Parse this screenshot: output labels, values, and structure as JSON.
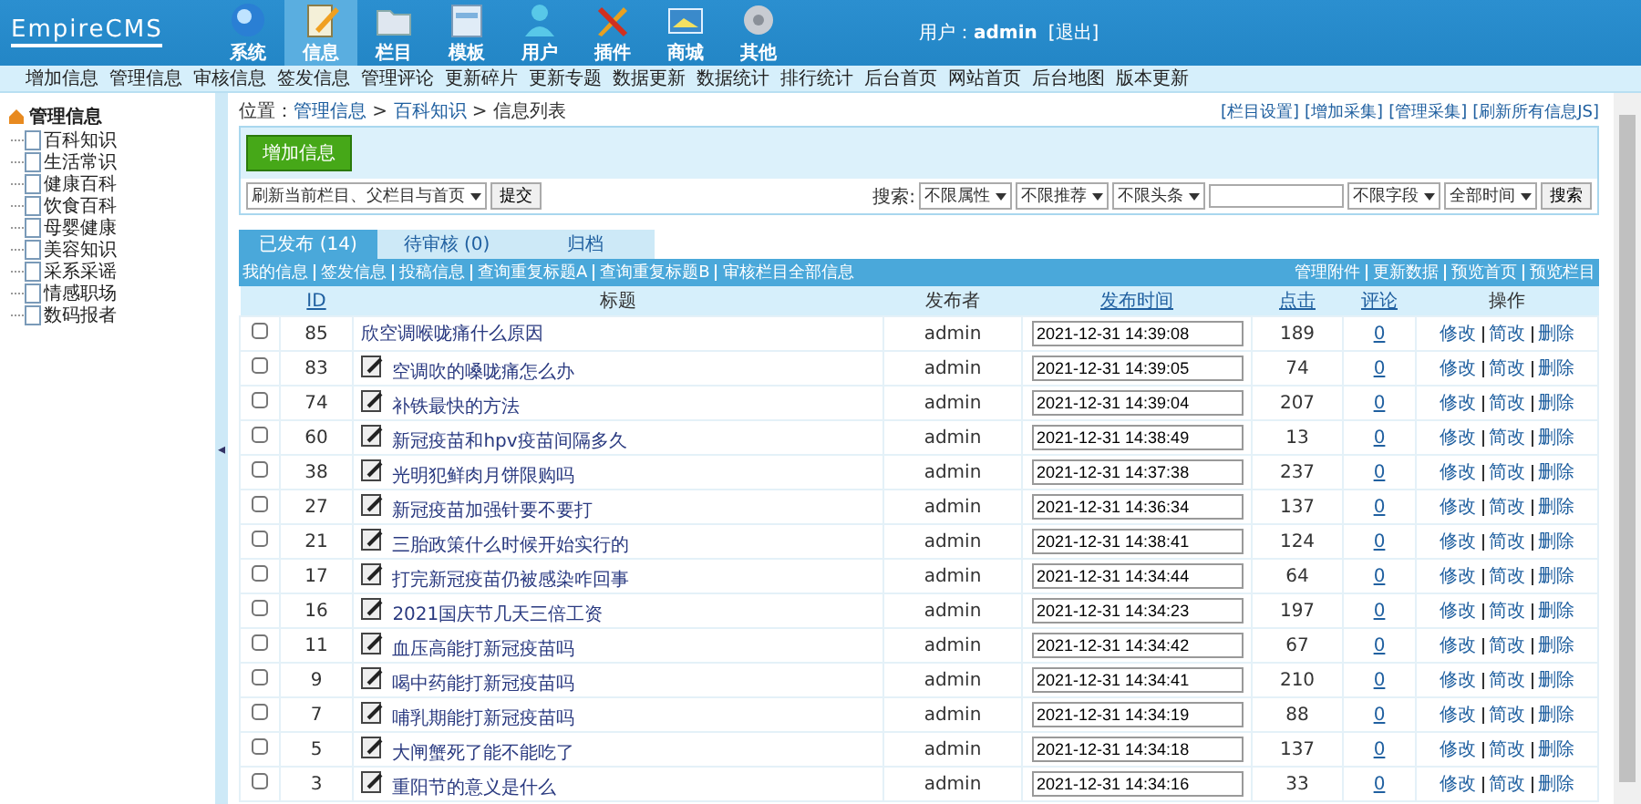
{
  "header": {
    "logo": "EmpireCMS",
    "nav": [
      {
        "label": "系统",
        "kind": "globe",
        "selected": false
      },
      {
        "label": "信息",
        "kind": "notepad",
        "selected": true
      },
      {
        "label": "栏目",
        "kind": "folder",
        "selected": false
      },
      {
        "label": "模板",
        "kind": "window",
        "selected": false
      },
      {
        "label": "用户",
        "kind": "person",
        "selected": false
      },
      {
        "label": "插件",
        "kind": "tools",
        "selected": false
      },
      {
        "label": "商城",
        "kind": "card",
        "selected": false
      },
      {
        "label": "其他",
        "kind": "gear",
        "selected": false
      }
    ],
    "user_label": "用户：",
    "user": "admin",
    "logout": "[退出]"
  },
  "submenu": [
    "增加信息",
    "管理信息",
    "审核信息",
    "签发信息",
    "管理评论",
    "更新碎片",
    "更新专题",
    "数据更新",
    "数据统计",
    "排行统计",
    "后台首页",
    "网站首页",
    "后台地图",
    "版本更新"
  ],
  "sidebar": {
    "tree": [
      {
        "label": "管理信息",
        "children": [
          {
            "label": "百科知识"
          },
          {
            "label": "生活常识"
          },
          {
            "label": "健康百科"
          },
          {
            "label": "饮食百科"
          },
          {
            "label": "母婴健康"
          },
          {
            "label": "美容知识"
          },
          {
            "label": "采系采谣"
          },
          {
            "label": "情感职场"
          },
          {
            "label": "数码报者"
          }
        ]
      }
    ],
    "collapse": "◂"
  },
  "breadcrumb": {
    "label": "位置：",
    "items": [
      {
        "text": "管理信息",
        "kind": "link"
      },
      {
        "text": " > ",
        "kind": "sep"
      },
      {
        "text": "百科知识",
        "kind": "link"
      },
      {
        "text": " > 信息列表",
        "kind": "text"
      }
    ]
  },
  "top_links": [
    "[栏目设置]",
    "[增加采集]",
    "[管理采集]",
    "[刷新所有信息JS]"
  ],
  "add_button": "增加信息",
  "refresh_select": "刷新当前栏目、父栏目与首页",
  "submit_button": "提交",
  "search": {
    "label": "搜索:",
    "filters": [
      "不限属性",
      "不限推荐",
      "不限头条"
    ],
    "field_filters": [
      "不限字段",
      "全部时间"
    ],
    "button": "搜索"
  },
  "tabs": [
    {
      "label": "已发布 (14)",
      "selected": true
    },
    {
      "label": "待审核 (0)",
      "selected": false
    },
    {
      "label": "归档",
      "selected": false
    }
  ],
  "links_left": [
    "我的信息",
    "签发信息",
    "投稿信息",
    "查询重复标题A",
    "查询重复标题B",
    "审核栏目全部信息"
  ],
  "links_right": [
    "管理附件",
    "更新数据",
    "预览首页",
    "预览栏目"
  ],
  "table": {
    "columns": [
      {
        "kind": "blank"
      },
      {
        "label": "ID",
        "kind": "link"
      },
      {
        "label": "标题",
        "kind": "plain"
      },
      {
        "label": "发布者",
        "kind": "plain"
      },
      {
        "label": "发布时间",
        "kind": "link"
      },
      {
        "label": "点击",
        "kind": "link"
      },
      {
        "label": "评论",
        "kind": "link"
      },
      {
        "label": "操作",
        "kind": "plain"
      }
    ],
    "rows": [
      {
        "checked": false,
        "id": "85",
        "title": "欣空调喉咙痛什么原因",
        "edit_icon": false,
        "author": "admin",
        "time": "2021-12-31 14:39:08",
        "clicks": "189",
        "comments": "0",
        "actions": [
          "修改",
          "简改",
          "删除"
        ]
      },
      {
        "checked": false,
        "id": "83",
        "title": "空调吹的嗓咙痛怎么办",
        "edit_icon": true,
        "author": "admin",
        "time": "2021-12-31 14:39:05",
        "clicks": "74",
        "comments": "0",
        "actions": [
          "修改",
          "简改",
          "删除"
        ]
      },
      {
        "checked": false,
        "id": "74",
        "title": "补铁最快的方法",
        "edit_icon": true,
        "author": "admin",
        "time": "2021-12-31 14:39:04",
        "clicks": "207",
        "comments": "0",
        "actions": [
          "修改",
          "简改",
          "删除"
        ]
      },
      {
        "checked": false,
        "id": "60",
        "title": "新冠疫苗和hpv疫苗间隔多久",
        "edit_icon": true,
        "author": "admin",
        "time": "2021-12-31 14:38:49",
        "clicks": "13",
        "comments": "0",
        "actions": [
          "修改",
          "简改",
          "删除"
        ]
      },
      {
        "checked": false,
        "id": "38",
        "title": "光明犯鲜肉月饼限购吗",
        "edit_icon": true,
        "author": "admin",
        "time": "2021-12-31 14:37:38",
        "clicks": "237",
        "comments": "0",
        "actions": [
          "修改",
          "简改",
          "删除"
        ]
      },
      {
        "checked": false,
        "id": "27",
        "title": "新冠疫苗加强针要不要打",
        "edit_icon": true,
        "author": "admin",
        "time": "2021-12-31 14:36:34",
        "clicks": "137",
        "comments": "0",
        "actions": [
          "修改",
          "简改",
          "删除"
        ]
      },
      {
        "checked": false,
        "id": "21",
        "title": "三胎政策什么时候开始实行的",
        "edit_icon": true,
        "author": "admin",
        "time": "2021-12-31 14:38:41",
        "clicks": "124",
        "comments": "0",
        "actions": [
          "修改",
          "简改",
          "删除"
        ]
      },
      {
        "checked": false,
        "id": "17",
        "title": "打完新冠疫苗仍被感染咋回事",
        "edit_icon": true,
        "author": "admin",
        "time": "2021-12-31 14:34:44",
        "clicks": "64",
        "comments": "0",
        "actions": [
          "修改",
          "简改",
          "删除"
        ]
      },
      {
        "checked": false,
        "id": "16",
        "title": "2021国庆节几天三倍工资",
        "edit_icon": true,
        "author": "admin",
        "time": "2021-12-31 14:34:23",
        "clicks": "197",
        "comments": "0",
        "actions": [
          "修改",
          "简改",
          "删除"
        ]
      },
      {
        "checked": false,
        "id": "11",
        "title": "血压高能打新冠疫苗吗",
        "edit_icon": true,
        "author": "admin",
        "time": "2021-12-31 14:34:42",
        "clicks": "67",
        "comments": "0",
        "actions": [
          "修改",
          "简改",
          "删除"
        ]
      },
      {
        "checked": false,
        "id": "9",
        "title": "喝中药能打新冠疫苗吗",
        "edit_icon": true,
        "author": "admin",
        "time": "2021-12-31 14:34:41",
        "clicks": "210",
        "comments": "0",
        "actions": [
          "修改",
          "简改",
          "删除"
        ]
      },
      {
        "checked": false,
        "id": "7",
        "title": "哺乳期能打新冠疫苗吗",
        "edit_icon": true,
        "author": "admin",
        "time": "2021-12-31 14:34:19",
        "clicks": "88",
        "comments": "0",
        "actions": [
          "修改",
          "简改",
          "删除"
        ]
      },
      {
        "checked": false,
        "id": "5",
        "title": "大闸蟹死了能不能吃了",
        "edit_icon": true,
        "author": "admin",
        "time": "2021-12-31 14:34:18",
        "clicks": "137",
        "comments": "0",
        "actions": [
          "修改",
          "简改",
          "删除"
        ]
      },
      {
        "checked": false,
        "id": "3",
        "title": "重阳节的意义是什么",
        "edit_icon": true,
        "author": "admin",
        "time": "2021-12-31 14:34:16",
        "clicks": "33",
        "comments": "0",
        "actions": [
          "修改",
          "简改",
          "删除"
        ]
      }
    ]
  }
}
